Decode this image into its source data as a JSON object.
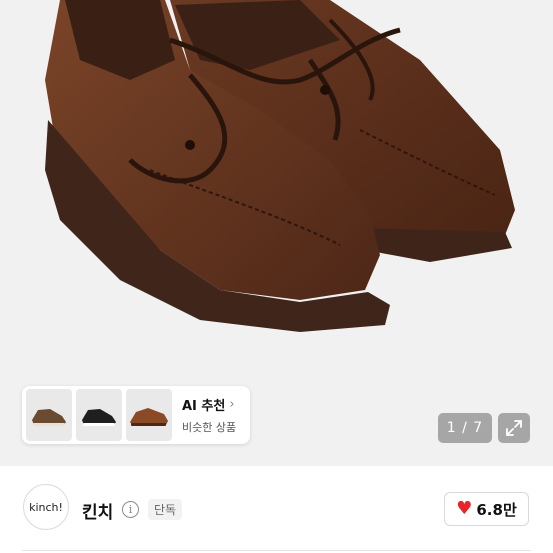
{
  "gallery": {
    "image_icon": "shoe-photo",
    "counter": "1 / 7",
    "expand_icon": "expand-arrows-icon"
  },
  "recommendation": {
    "title": "AI 추천",
    "chevron": "›",
    "subtitle": "비슷한 상품",
    "thumbnails": [
      {
        "color": "#6a4a30",
        "icon": "brown-sneaker-thumbnail"
      },
      {
        "color": "#1f1f1f",
        "icon": "black-sneaker-thumbnail"
      },
      {
        "color": "#8b4a26",
        "icon": "brown-loafer-thumbnail"
      }
    ]
  },
  "brand": {
    "logo_text": "kinch!",
    "name": "킨치",
    "info_symbol": "i",
    "badge": "단독"
  },
  "likes": {
    "heart": "♥",
    "count": "6.8만",
    "heart_color": "#e8242b"
  }
}
